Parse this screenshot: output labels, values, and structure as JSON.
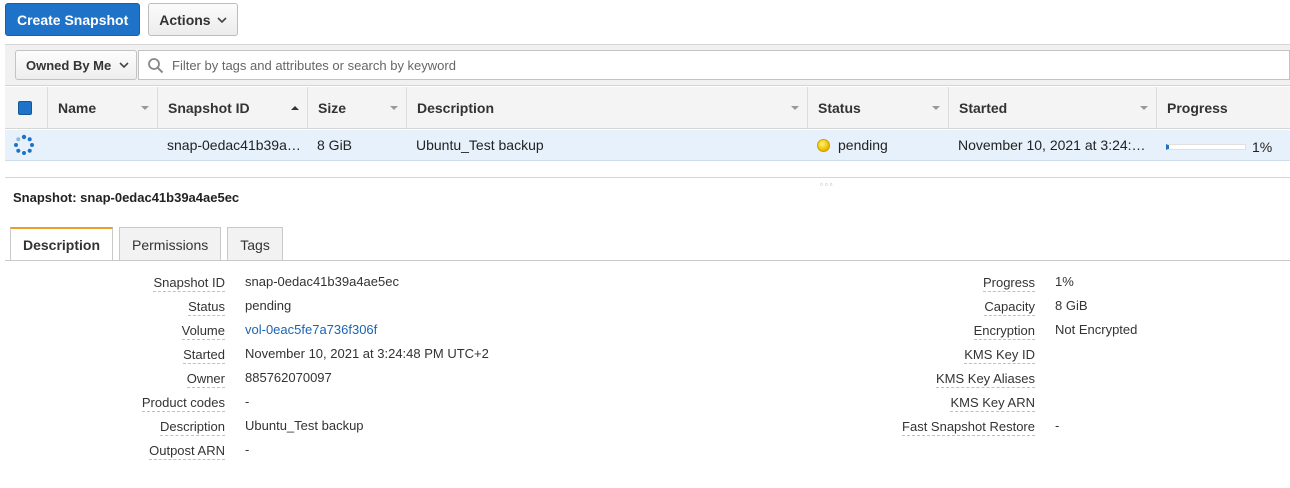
{
  "toolbar": {
    "create_label": "Create Snapshot",
    "actions_label": "Actions"
  },
  "filter": {
    "owned_label": "Owned By Me",
    "search_placeholder": "Filter by tags and attributes or search by keyword"
  },
  "table": {
    "columns": [
      "Name",
      "Snapshot ID",
      "Size",
      "Description",
      "Status",
      "Started",
      "Progress"
    ],
    "rows": [
      {
        "name": "",
        "snapshot_id": "snap-0edac41b39a…",
        "size": "8 GiB",
        "description": "Ubuntu_Test backup",
        "status": "pending",
        "started": "November 10, 2021 at 3:24:…",
        "progress": "1%",
        "progress_fraction": 0.01
      }
    ]
  },
  "detail": {
    "title": "Snapshot: snap-0edac41b39a4ae5ec",
    "tabs": [
      "Description",
      "Permissions",
      "Tags"
    ],
    "left": [
      {
        "label": "Snapshot ID",
        "value": "snap-0edac41b39a4ae5ec"
      },
      {
        "label": "Status",
        "value": "pending"
      },
      {
        "label": "Volume",
        "value": "vol-0eac5fe7a736f306f"
      },
      {
        "label": "Started",
        "value": "November 10, 2021 at 3:24:48 PM UTC+2"
      },
      {
        "label": "Owner",
        "value": "885762070097"
      },
      {
        "label": "Product codes",
        "value": "-"
      },
      {
        "label": "Description",
        "value": "Ubuntu_Test backup"
      },
      {
        "label": "Outpost ARN",
        "value": "-"
      }
    ],
    "right": [
      {
        "label": "Progress",
        "value": "1%"
      },
      {
        "label": "Capacity",
        "value": "8 GiB"
      },
      {
        "label": "Encryption",
        "value": "Not Encrypted"
      },
      {
        "label": "KMS Key ID",
        "value": ""
      },
      {
        "label": "KMS Key Aliases",
        "value": ""
      },
      {
        "label": "KMS Key ARN",
        "value": ""
      },
      {
        "label": "Fast Snapshot Restore",
        "value": "-"
      }
    ]
  },
  "colors": {
    "primary": "#1e73c9",
    "selected_row": "#e7f1fb",
    "tab_accent": "#e8a02a",
    "link": "#1a64b5",
    "pending": "#f0c000"
  }
}
